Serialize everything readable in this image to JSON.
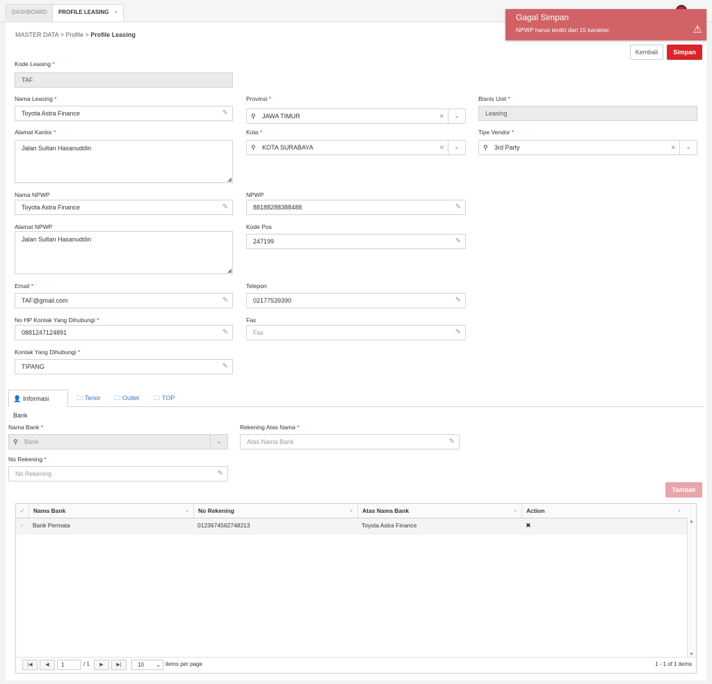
{
  "tabs": [
    {
      "label": "DASHBOARD"
    },
    {
      "label": "PROFILE LEASING",
      "close": "×"
    }
  ],
  "breadcrumb": {
    "part1": "MASTER DATA",
    "sep": ">",
    "part2": "Profile",
    "part3": "Profile Leasing"
  },
  "actions": {
    "back": "Kembali",
    "save": "Simpan"
  },
  "toast": {
    "title": "Gagal Simpan",
    "message": "NPWP harus terdiri dari 15 karakter.",
    "icon": "⚠"
  },
  "form": {
    "kode_leasing": {
      "label": "Kode Leasing",
      "value": "TAF"
    },
    "nama_leasing": {
      "label": "Nama Leasing",
      "value": "Toyota Astra Finance"
    },
    "provinsi": {
      "label": "Provinsi",
      "value": "JAWA TIMUR"
    },
    "bisnis_unit": {
      "label": "Bisnis Unit",
      "value": "Leasing"
    },
    "alamat_kantor": {
      "label": "Alamat Kantor",
      "value": "Jalan Sultan Hasanuddin"
    },
    "kota": {
      "label": "Kota",
      "value": "KOTA SURABAYA"
    },
    "tipe_vendor": {
      "label": "Tipe Vendor",
      "value": "3rd Party"
    },
    "nama_npwp": {
      "label": "Nama NPWP",
      "value": "Toyota Astra Finance"
    },
    "npwp": {
      "label": "NPWP",
      "value": "88188288388488"
    },
    "alamat_npwp": {
      "label": "Alamat NPWP",
      "value": "Jalan Sultan Hasanuddin"
    },
    "kode_pos": {
      "label": "Kode Pos",
      "value": "247199"
    },
    "email": {
      "label": "Email",
      "value": "TAF@gmail.com"
    },
    "telepon": {
      "label": "Telepon",
      "value": "02177539390"
    },
    "no_hp": {
      "label": "No HP Kontak Yang Dihubungi",
      "value": "0881247124891"
    },
    "fax": {
      "label": "Fax",
      "placeholder": "Fax"
    },
    "kontak": {
      "label": "Kontak Yang Dihubungi",
      "value": "TIPANG"
    },
    "required_mark": "*"
  },
  "subtabs": [
    {
      "label": "Informasi Bank"
    },
    {
      "label": "Tenor"
    },
    {
      "label": "Outlet"
    },
    {
      "label": "TOP"
    }
  ],
  "bank": {
    "nama_bank": {
      "label": "Nama Bank",
      "placeholder": "Bank"
    },
    "rekening_atas_nama": {
      "label": "Rekening Atas Nama",
      "placeholder": "Atas Nama Bank"
    },
    "no_rekening": {
      "label": "No Rekening",
      "placeholder": "No Rekening"
    },
    "add": "Tambah"
  },
  "grid": {
    "columns": [
      "Nama Bank",
      "No Rekening",
      "Atas Nama Bank",
      "Action"
    ],
    "rows": [
      {
        "nama_bank": "Bank Permata",
        "no_rekening": "0123674562748213",
        "atas_nama": "Toyota Astra Finance",
        "action": "✖"
      }
    ],
    "pager": {
      "page": "1",
      "of": "/ 1",
      "per_page": "10",
      "per_page_label": "items per page",
      "summary": "1 - 1 of 1 items"
    }
  }
}
